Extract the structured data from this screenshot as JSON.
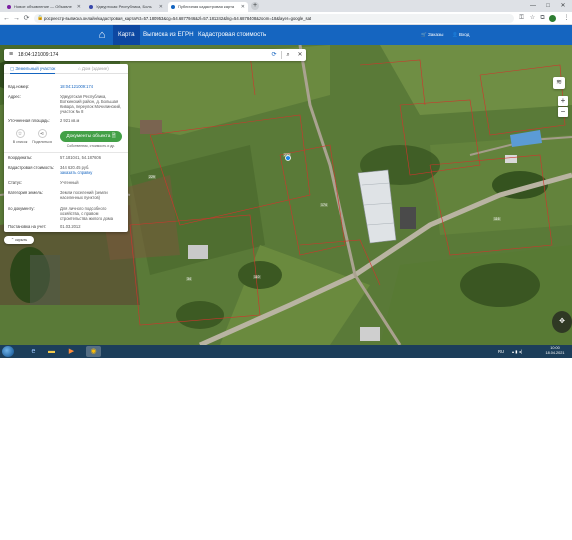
{
  "browser": {
    "tabs": [
      {
        "title": "Новое объявление — Объявле",
        "favicon_color": "#7b1fa2",
        "active": false
      },
      {
        "title": "Удмуртская Республика, Боль",
        "favicon_color": "#3949ab",
        "active": false
      },
      {
        "title": "Публичная кадастровая карта",
        "favicon_color": "#1565c0",
        "active": true
      }
    ],
    "new_tab": "+",
    "window_controls": [
      "—",
      "□",
      "✕"
    ],
    "url": "росреестр-выписка.онлайн/кадастровая_карта#ct=57.180953&cg=54.6877946&zl=57.181242&lng=54.6878408&zoom=18&layer=google_sat"
  },
  "site": {
    "nav": {
      "home_icon": "home-icon",
      "map": "Карта",
      "egrn": "Выписка из ЕГРН",
      "cadastral_value": "Кадастровая стоимость"
    },
    "orders": "Заказы",
    "login": "Вход"
  },
  "search": {
    "value": "18:04:121009:174",
    "placeholder": ""
  },
  "panel": {
    "tabs": {
      "land": "Земельный участок",
      "building": "Дом (здание)"
    },
    "rows": {
      "cad_number": {
        "label": "Кад.номер:",
        "value": "18:04:121009:174"
      },
      "address": {
        "label": "Адрес:",
        "value": "Удмуртская Республика, Воткинский район, д. Большая Кивара, переулок Мочилинский, участок № 8"
      },
      "area": {
        "label": "Уточненная площадь:",
        "value": "2 921 кв.м"
      },
      "coords": {
        "label": "Координаты:",
        "value": "57.181041, 54.187606"
      },
      "value": {
        "label": "Кадастровая стоимость:",
        "value": "344 620.45 руб.",
        "link": "заказать справку"
      },
      "status": {
        "label": "Статус:",
        "value": "Учтенный"
      },
      "category": {
        "label": "Категория земель:",
        "value": "Земли поселений (земли населенных пунктов)"
      },
      "usage": {
        "label": "по документу:",
        "value": "Для личного подсобного хозяйства, с правом строительства жилого дома"
      },
      "registered": {
        "label": "Постановка на учет:",
        "value": "01.03.2012"
      }
    },
    "actions": {
      "list": "В список",
      "share": "Поделиться",
      "documents": "Документы объекта",
      "documents_sub": "Собственник, стоимость и др."
    },
    "hide": "скрыть"
  },
  "map": {
    "plot_labels": [
      "233",
      "174",
      "229",
      "110",
      "116",
      "34"
    ],
    "zoom_in": "+",
    "zoom_out": "−"
  },
  "taskbar": {
    "lang": "RU",
    "time": "10:00",
    "date": "18.04.2021"
  }
}
